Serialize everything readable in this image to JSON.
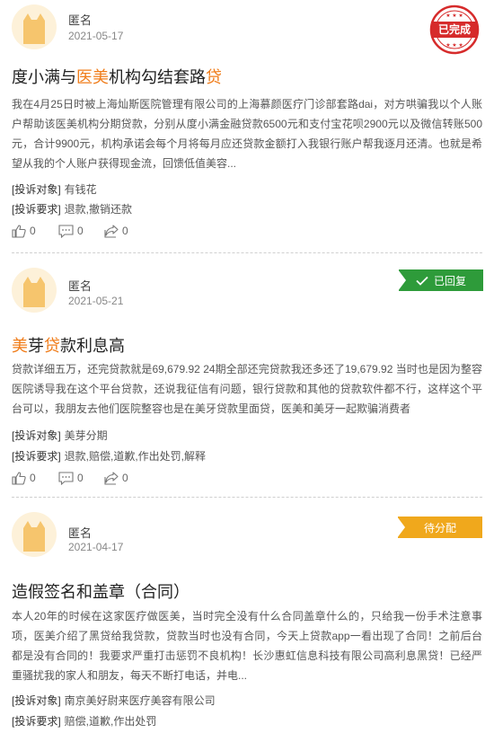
{
  "complaints": [
    {
      "user": "匿名",
      "date": "2021-05-17",
      "status": "已完成",
      "title_parts": [
        "度小满与",
        "医美",
        "机构勾结套路",
        "贷"
      ],
      "body": "我在4月25日时被上海灿斯医院管理有限公司的上海慕颜医疗门诊部套路dai，对方哄骗我以个人账户帮助该医美机构分期贷款，分别从度小满金融贷款6500元和支付宝花呗2900元以及微信转账500元，合计9900元，机构承诺会每个月将每月应还贷款金额打入我银行账户帮我逐月还清。也就是希望从我的个人账户获得现金流，回馈低值美容...",
      "target_label": "[投诉对象]",
      "target": "有钱花",
      "request_label": "[投诉要求]",
      "request": "退款,撤销还款",
      "likes": "0",
      "comments": "0",
      "shares": "0"
    },
    {
      "user": "匿名",
      "date": "2021-05-21",
      "status": "已回复",
      "title_parts": [
        "美",
        "芽",
        "贷",
        "款利息高"
      ],
      "body": "贷款详细五万，还完贷款就是69,679.92 24期全部还完贷款我还多还了19,679.92 当时也是因为整容医院诱导我在这个平台贷款，还说我征信有问题，银行贷款和其他的贷款软件都不行，这样这个平台可以，我朋友去他们医院整容也是在美牙贷款里面贷，医美和美牙一起欺骗消费者",
      "target_label": "[投诉对象]",
      "target": "美芽分期",
      "request_label": "[投诉要求]",
      "request": "退款,赔偿,道歉,作出处罚,解释",
      "likes": "0",
      "comments": "0",
      "shares": "0"
    },
    {
      "user": "匿名",
      "date": "2021-04-17",
      "status": "待分配",
      "title_parts": [
        "造假签名和盖章（合同）"
      ],
      "body": "本人20年的时候在这家医疗做医美，当时完全没有什么合同盖章什么的，只给我一份手术注意事项，医美介绍了黑贷给我贷款，贷款当时也没有合同，今天上贷款app一看出现了合同！之前后台都是没有合同的！我要求严重打击惩罚不良机构！长沙惠虹信息科技有限公司高利息黑贷！已经严重骚扰我的家人和朋友，每天不断打电话，并电...",
      "target_label": "[投诉对象]",
      "target": "南京美好尉来医疗美容有限公司",
      "request_label": "[投诉要求]",
      "request": "赔偿,道歉,作出处罚"
    }
  ],
  "colors": {
    "highlight": "#f07c19",
    "done": "#d62b2b",
    "replied": "#2e9b3a",
    "pending": "#f0a81c"
  },
  "icons": {
    "like": "thumbs-up-icon",
    "comment": "comment-icon",
    "share": "share-icon",
    "avatar": "cat-avatar-icon"
  }
}
